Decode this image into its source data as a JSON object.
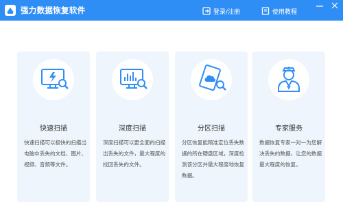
{
  "app": {
    "title": "强力数据恢复软件"
  },
  "header": {
    "login_label": "登录/注册",
    "tutorial_label": "使用教程"
  },
  "colors": {
    "titlebar_bg": "#2f8ef6",
    "card_bg": "#eef5fc",
    "icon_blue": "#2f8ef6"
  },
  "cards": [
    {
      "title": "快速扫描",
      "desc": "快速扫描可以极快的扫描出电脑中丢失的文档、图片、视频、音频等文件。",
      "icon": "monitor-lightning-search-icon"
    },
    {
      "title": "深度扫描",
      "desc": "深度扫描可以更全面的扫描出丢失的文件，最大程度的找回丢失的文件。",
      "icon": "monitor-chart-search-icon"
    },
    {
      "title": "分区扫描",
      "desc": "分区恢复能精准定位丢失数据的所在硬盘区域，深度检测该分区并最大程度地恢复数据。",
      "icon": "disk-cloud-search-icon"
    },
    {
      "title": "专家服务",
      "desc": "数据恢复专家一对一为您解决丢失的数据，让您的数据最大程度的恢复。",
      "icon": "expert-person-icon"
    }
  ]
}
